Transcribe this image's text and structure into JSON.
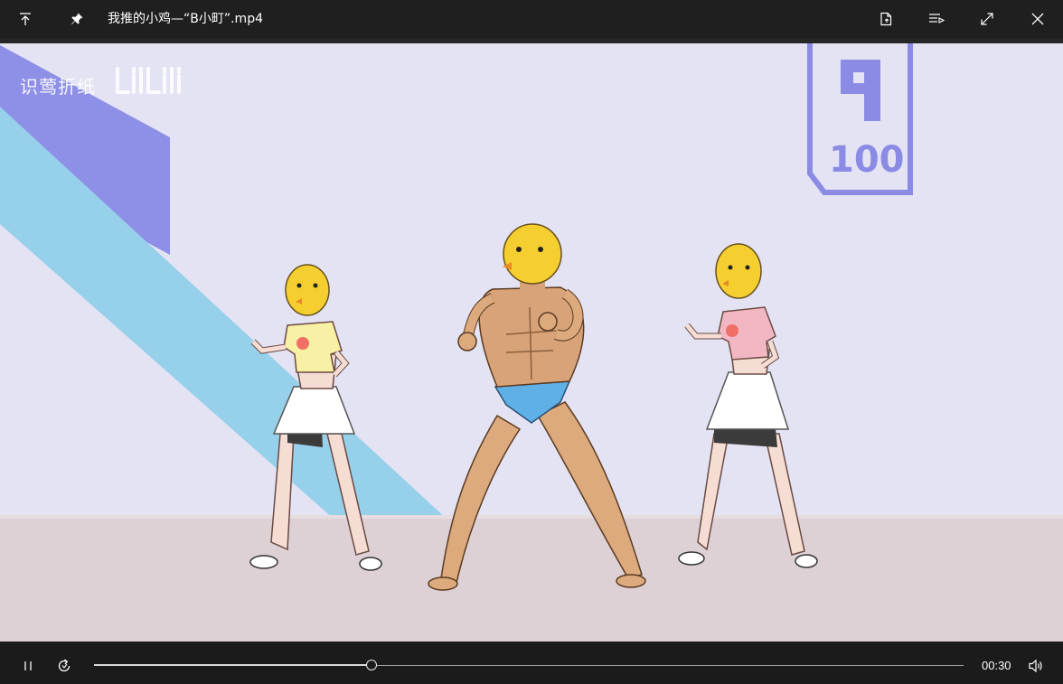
{
  "window": {
    "title": "我推的小鸡—“B小町”.mp4",
    "icons": [
      "move-up-icon",
      "pin-icon",
      "file-icon",
      "playlist-icon",
      "fullscreen-icon",
      "close-icon"
    ]
  },
  "video": {
    "watermark_text": "识莺折纸",
    "watermark_logo": "bilibili",
    "badge_text": "100",
    "colors": {
      "background": "#e3e3f3",
      "stripe_purple": "#8e8fe6",
      "stripe_blue": "#97d0ea",
      "floor": "#ddd1d6"
    }
  },
  "player": {
    "time": "00:30",
    "progress_fraction": 0.319,
    "icons": [
      "pause-icon",
      "repeat-icon",
      "volume-icon"
    ]
  }
}
